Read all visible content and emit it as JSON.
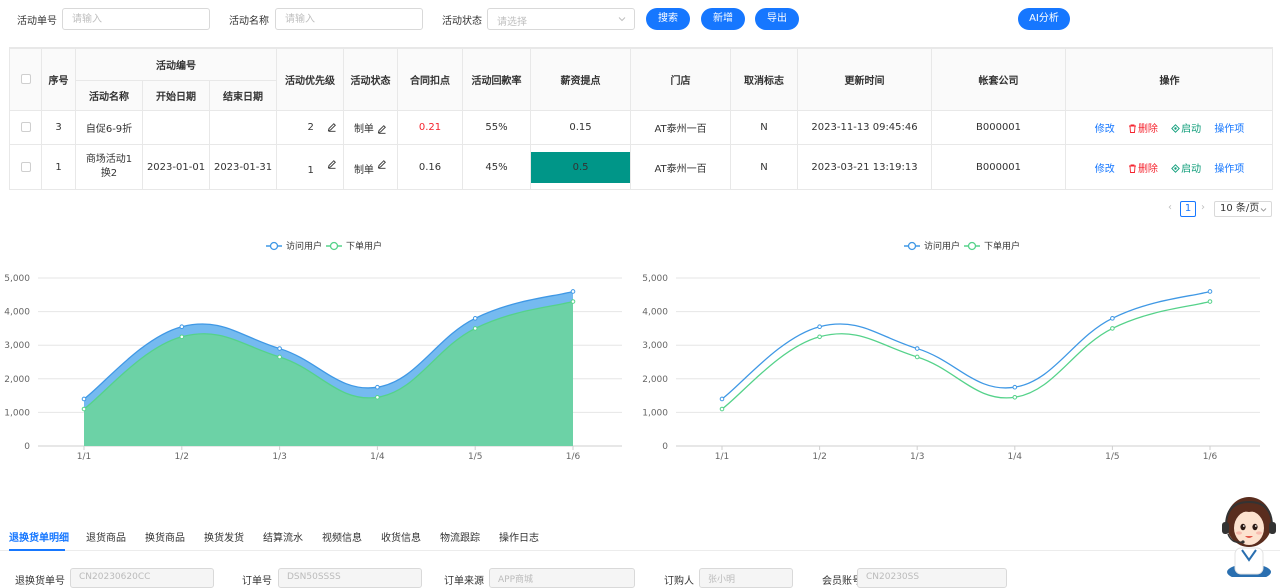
{
  "filters": {
    "order_label": "活动单号",
    "order_placeholder": "请输入",
    "name_label": "活动名称",
    "name_placeholder": "请输入",
    "status_label": "活动状态",
    "status_placeholder": "请选择",
    "search_btn": "搜索",
    "add_btn": "新增",
    "export_btn": "导出",
    "ai_btn": "AI分析"
  },
  "table": {
    "headers": {
      "index": "序号",
      "activity_no": "活动编号",
      "activity_name": "活动名称",
      "start_date": "开始日期",
      "end_date": "结束日期",
      "priority": "活动优先级",
      "status": "活动状态",
      "discount": "合同扣点",
      "payback": "活动回款率",
      "salary": "薪资提点",
      "store": "门店",
      "cancel": "取消标志",
      "updated": "更新时间",
      "company": "帐套公司",
      "ops": "操作"
    },
    "rows": [
      {
        "index": "3",
        "name": "自促6-9折",
        "start": "",
        "end": "",
        "priority": "2",
        "status": "制单",
        "discount": "0.21",
        "payback": "55%",
        "salary": "0.15",
        "store": "AT泰州一百",
        "cancel": "N",
        "updated": "2023-11-13 09:45:46",
        "company": "B000001"
      },
      {
        "index": "1",
        "name": "商场活动1换2",
        "start": "2023-01-01",
        "end": "2023-01-31",
        "priority": "1",
        "status": "制单",
        "discount": "0.16",
        "payback": "45%",
        "salary": "0.5",
        "store": "AT泰州一百",
        "cancel": "N",
        "updated": "2023-03-21 13:19:13",
        "company": "B000001"
      }
    ],
    "ops": {
      "edit": "修改",
      "delete": "删除",
      "start": "启动",
      "items": "操作项"
    }
  },
  "pagination": {
    "current": "1",
    "page_size": "10 条/页"
  },
  "colors": {
    "primary": "#1677ff",
    "danger": "#f5222d",
    "success": "#0f9d7a",
    "teal": "#009688",
    "visit": "#3f98e5",
    "order": "#55d28a"
  },
  "chart_data": [
    {
      "type": "area",
      "categories": [
        "1/1",
        "1/2",
        "1/3",
        "1/4",
        "1/5",
        "1/6"
      ],
      "series": [
        {
          "name": "访问用户",
          "values": [
            1400,
            3550,
            2900,
            1750,
            3800,
            4600
          ]
        },
        {
          "name": "下单用户",
          "values": [
            1100,
            3250,
            2650,
            1450,
            3500,
            4300
          ]
        }
      ],
      "ylim": [
        0,
        5000
      ],
      "yticks": [
        "0",
        "1,000",
        "2,000",
        "3,000",
        "4,000",
        "5,000"
      ],
      "legend": "top-center",
      "grid": true
    },
    {
      "type": "line",
      "categories": [
        "1/1",
        "1/2",
        "1/3",
        "1/4",
        "1/5",
        "1/6"
      ],
      "series": [
        {
          "name": "访问用户",
          "values": [
            1400,
            3550,
            2900,
            1750,
            3800,
            4600
          ]
        },
        {
          "name": "下单用户",
          "values": [
            1100,
            3250,
            2650,
            1450,
            3500,
            4300
          ]
        }
      ],
      "ylim": [
        0,
        5000
      ],
      "yticks": [
        "0",
        "1,000",
        "2,000",
        "3,000",
        "4,000",
        "5,000"
      ],
      "legend": "top-center",
      "grid": true
    }
  ],
  "tabs": [
    {
      "label": "退换货单明细",
      "active": true
    },
    {
      "label": "退货商品"
    },
    {
      "label": "换货商品"
    },
    {
      "label": "换货发货"
    },
    {
      "label": "结算流水"
    },
    {
      "label": "视频信息"
    },
    {
      "label": "收货信息"
    },
    {
      "label": "物流跟踪"
    },
    {
      "label": "操作日志"
    }
  ],
  "detail_form": {
    "f1_label": "退换货单号",
    "f1_value": "CN20230620CC",
    "f2_label": "订单号",
    "f2_value": "DSN50SSSS",
    "f3_label": "订单来源",
    "f3_value": "APP商城",
    "f4_label": "订购人",
    "f4_value": "张小明",
    "f5_label": "会员账号",
    "f5_value": "CN20230SS"
  }
}
